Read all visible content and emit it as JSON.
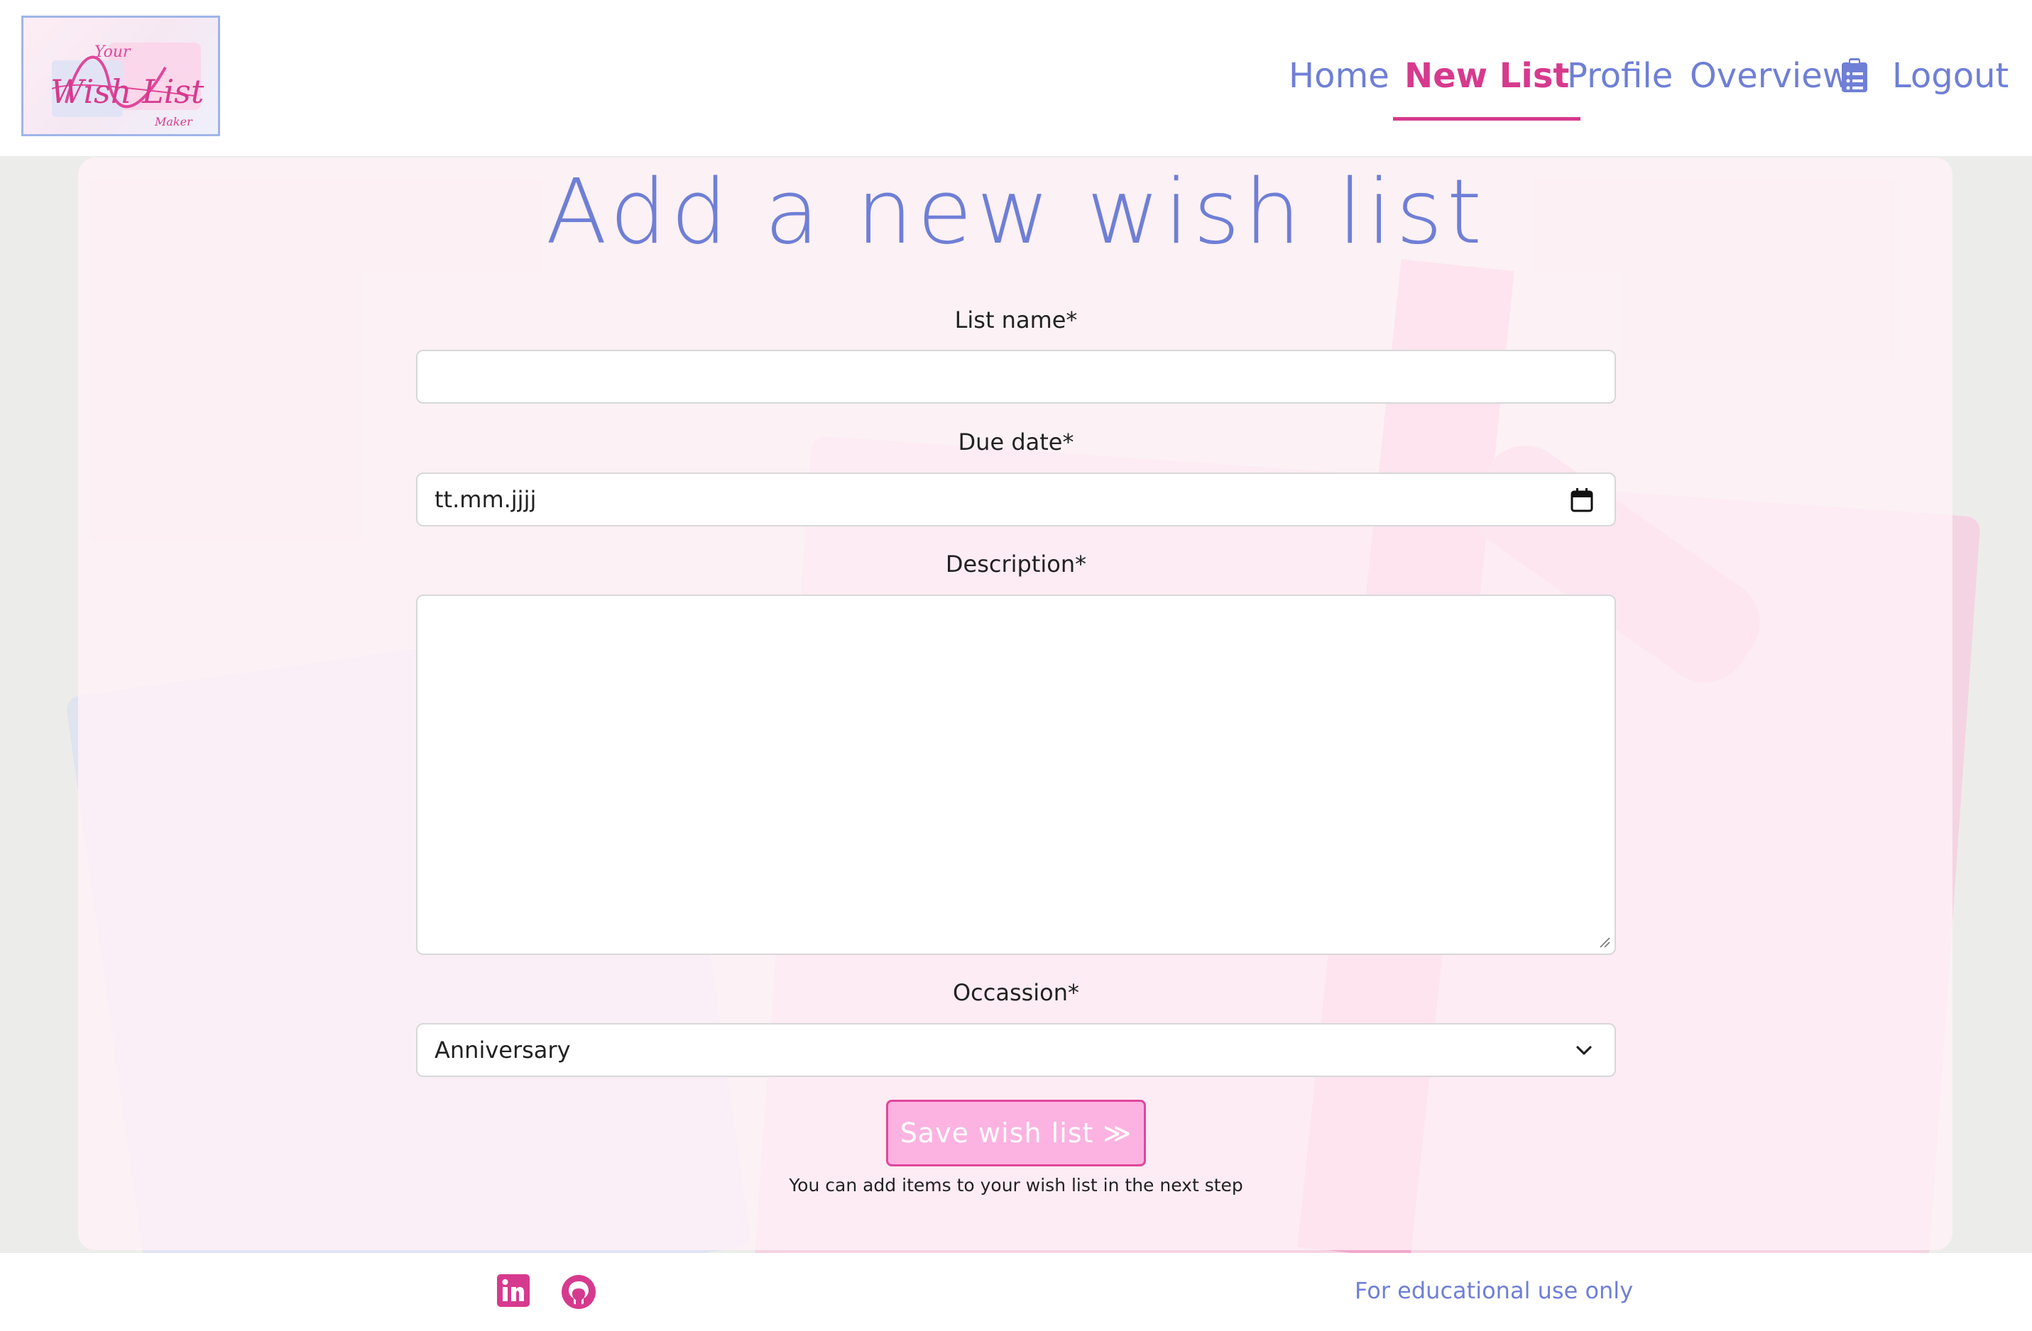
{
  "brand": {
    "logo_text_small": "Your",
    "logo_text_main": "Wish List",
    "logo_text_sub": "Maker"
  },
  "nav": {
    "items": [
      {
        "label": "Home",
        "active": false
      },
      {
        "label": "New List",
        "active": true
      },
      {
        "label": "Profile",
        "active": false
      },
      {
        "label": "Overview",
        "active": false,
        "icon": "clipboard-list-icon"
      },
      {
        "label": "Logout",
        "active": false
      }
    ]
  },
  "form": {
    "title": "Add a new wish list",
    "list_name": {
      "label": "List name*",
      "value": ""
    },
    "due_date": {
      "label": "Due date*",
      "value": "tt.mm.jjjj",
      "icon": "calendar-icon"
    },
    "description": {
      "label": "Description*",
      "value": ""
    },
    "occasion": {
      "label": "Occassion*",
      "selected": "Anniversary",
      "icon": "chevron-down-icon"
    },
    "save_button": "Save wish list ≫",
    "hint": "You can add items to your wish list in the next step"
  },
  "footer": {
    "social": [
      {
        "icon": "linkedin-icon"
      },
      {
        "icon": "github-icon"
      }
    ],
    "note": "For educational use only"
  },
  "colors": {
    "accent_pink": "#d63a8e",
    "accent_blue": "#6f7fd6",
    "button_bg": "#fcb3e1"
  }
}
